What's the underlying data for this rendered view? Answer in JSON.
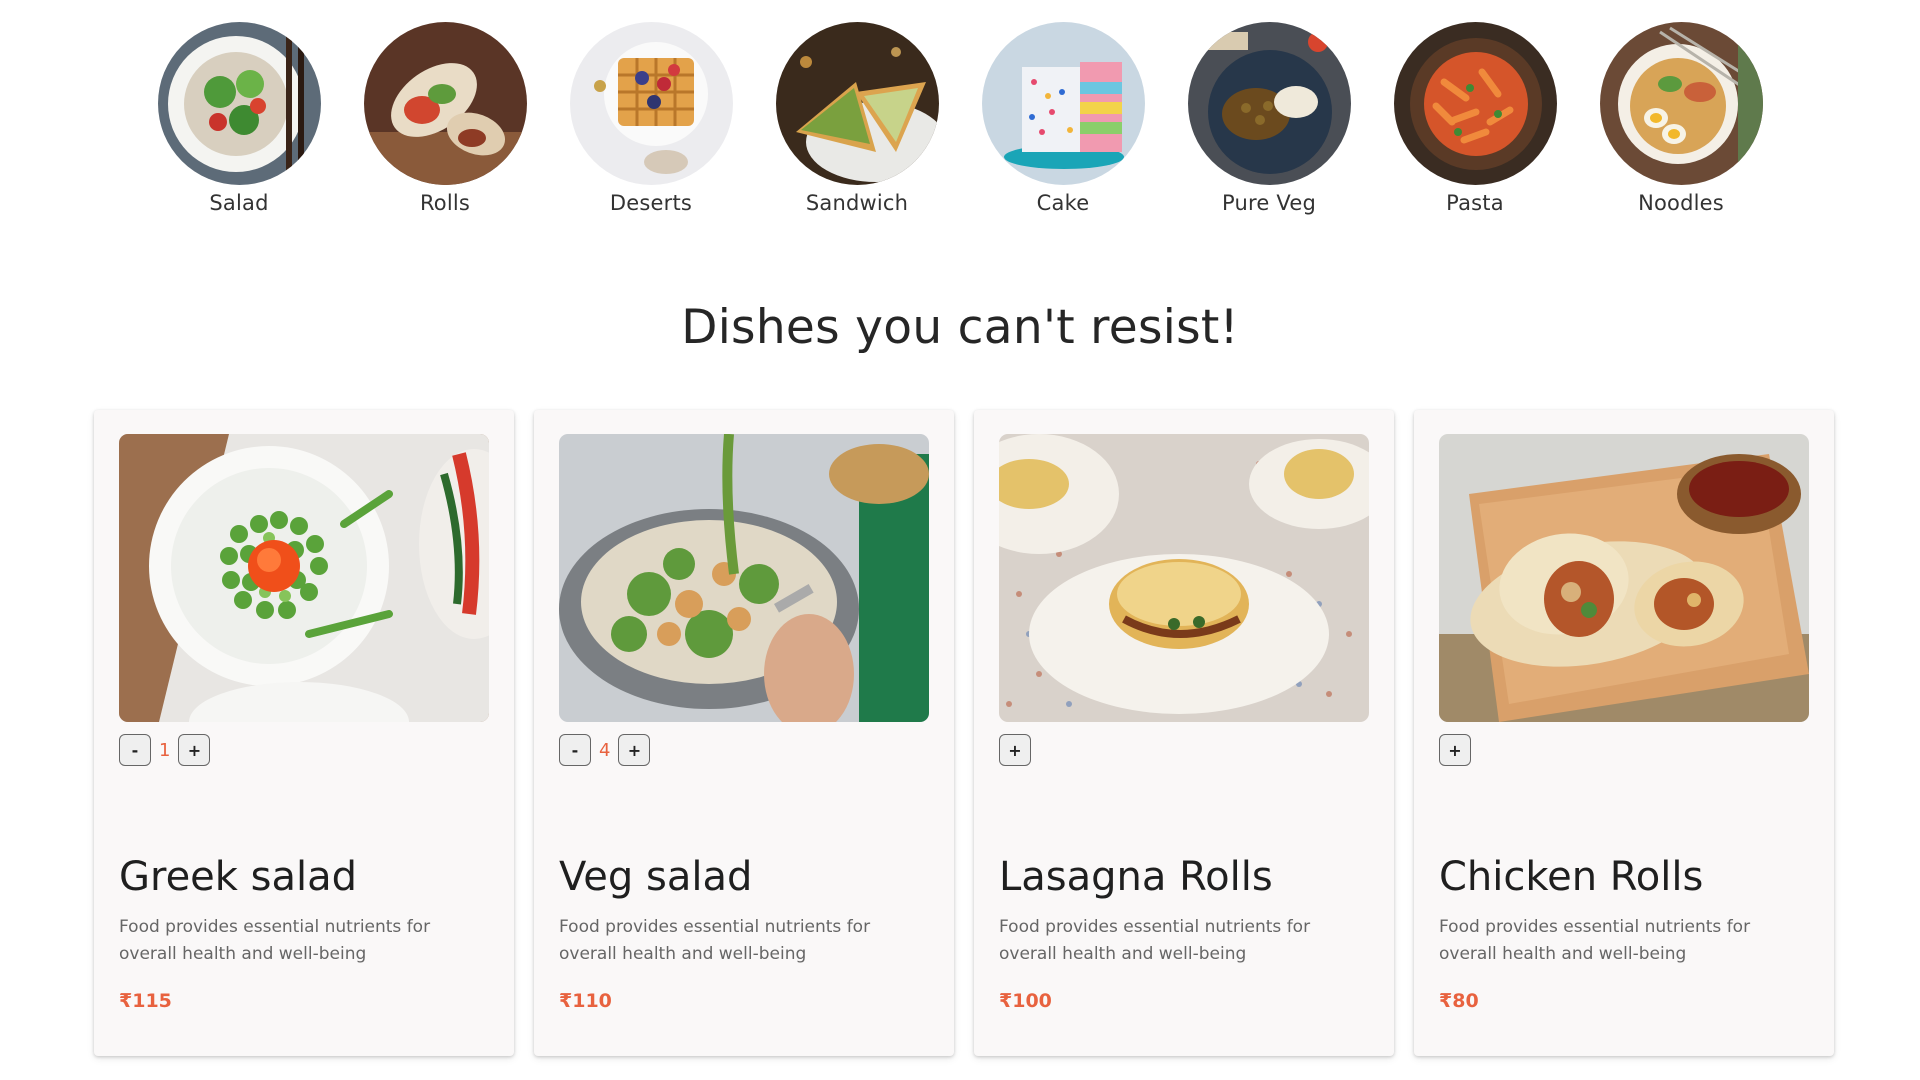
{
  "categories": [
    {
      "label": "Salad",
      "icon": "salad-photo"
    },
    {
      "label": "Rolls",
      "icon": "rolls-photo"
    },
    {
      "label": "Deserts",
      "icon": "waffle-photo"
    },
    {
      "label": "Sandwich",
      "icon": "sandwich-photo"
    },
    {
      "label": "Cake",
      "icon": "cake-photo"
    },
    {
      "label": "Pure Veg",
      "icon": "veg-curry-photo"
    },
    {
      "label": "Pasta",
      "icon": "pasta-photo"
    },
    {
      "label": "Noodles",
      "icon": "noodles-photo"
    }
  ],
  "section": {
    "title": "Dishes you can't resist!"
  },
  "dishes": [
    {
      "name": "Greek salad",
      "desc": "Food provides essential nutrients for overall health and well-being",
      "price": "₹115",
      "count": "1",
      "minus": "-",
      "plus": "+",
      "image": "greek-salad-photo"
    },
    {
      "name": "Veg salad",
      "desc": "Food provides essential nutrients for overall health and well-being",
      "price": "₹110",
      "count": "4",
      "minus": "-",
      "plus": "+",
      "image": "veg-salad-photo"
    },
    {
      "name": "Lasagna Rolls",
      "desc": "Food provides essential nutrients for overall health and well-being",
      "price": "₹100",
      "count": "",
      "minus": "",
      "plus": "+",
      "image": "lasagna-rolls-photo"
    },
    {
      "name": "Chicken Rolls",
      "desc": "Food provides essential nutrients for overall health and well-being",
      "price": "₹80",
      "count": "",
      "minus": "",
      "plus": "+",
      "image": "chicken-rolls-photo"
    }
  ],
  "colors": {
    "accent": "#e8623f",
    "card_bg": "#faf8f8",
    "text": "#262626"
  }
}
